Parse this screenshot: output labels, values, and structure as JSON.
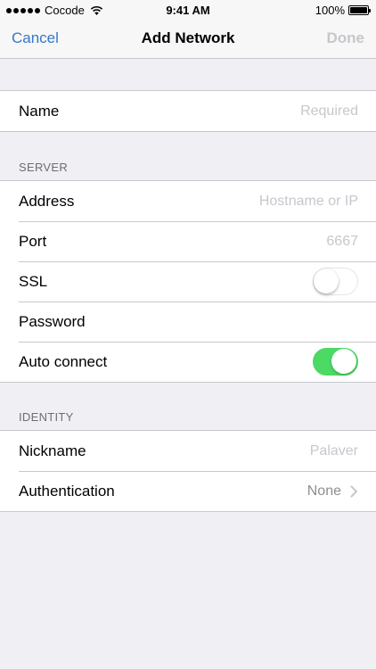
{
  "status_bar": {
    "carrier": "Cocode",
    "time": "9:41 AM",
    "battery": "100%"
  },
  "nav": {
    "cancel": "Cancel",
    "title": "Add Network",
    "done": "Done"
  },
  "name_section": {
    "label": "Name",
    "placeholder": "Required"
  },
  "server_section": {
    "header": "SERVER",
    "address": {
      "label": "Address",
      "placeholder": "Hostname or IP"
    },
    "port": {
      "label": "Port",
      "placeholder": "6667"
    },
    "ssl": {
      "label": "SSL",
      "on": false
    },
    "password": {
      "label": "Password",
      "placeholder": ""
    },
    "auto_connect": {
      "label": "Auto connect",
      "on": true
    }
  },
  "identity_section": {
    "header": "IDENTITY",
    "nickname": {
      "label": "Nickname",
      "placeholder": "Palaver"
    },
    "authentication": {
      "label": "Authentication",
      "value": "None"
    }
  },
  "colors": {
    "accent": "#3478c8",
    "switch_on": "#4cd964",
    "background": "#efeff4"
  }
}
